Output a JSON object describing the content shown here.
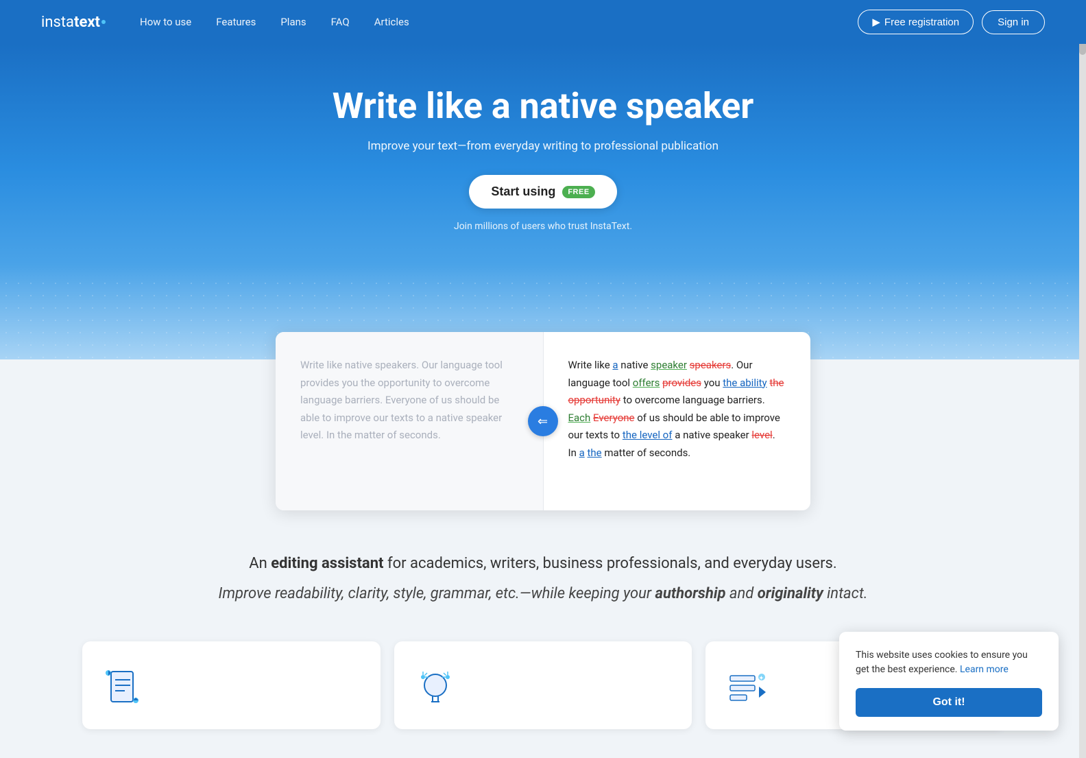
{
  "navbar": {
    "logo_insta": "insta",
    "logo_text": "text",
    "nav_links": [
      {
        "label": "How to use",
        "id": "how-to-use"
      },
      {
        "label": "Features",
        "id": "features"
      },
      {
        "label": "Plans",
        "id": "plans"
      },
      {
        "label": "FAQ",
        "id": "faq"
      },
      {
        "label": "Articles",
        "id": "articles"
      }
    ],
    "register_label": "Free registration",
    "register_icon": "▶",
    "signin_label": "Sign in"
  },
  "hero": {
    "title": "Write like a native speaker",
    "subtitle": "Improve your text—from everyday writing to professional publication",
    "start_label": "Start using",
    "free_badge": "FREE",
    "trust_text": "Join millions of users who trust InstaText."
  },
  "comparison": {
    "left_text": "Write like native speakers. Our language tool provides you the opportunity to overcome language barriers. Everyone of us should be able to improve our texts to a native speaker level. In the matter of seconds.",
    "toggle_icon": "⇐"
  },
  "section": {
    "line1_prefix": "An ",
    "line1_bold": "editing assistant",
    "line1_suffix": " for academics, writers, business professionals, and everyday users.",
    "line2_prefix": "Improve readability, clarity, style, grammar, etc.—while keeping your ",
    "line2_bold1": "authorship",
    "line2_middle": " and ",
    "line2_bold2": "originality",
    "line2_suffix": " intact."
  },
  "cookie": {
    "text": "This website uses cookies to ensure you get the best experience.",
    "learn_more": "Learn more",
    "button_label": "Got it!"
  },
  "colors": {
    "primary": "#1a6fc4",
    "green": "#4caf50",
    "red": "#e53935"
  }
}
